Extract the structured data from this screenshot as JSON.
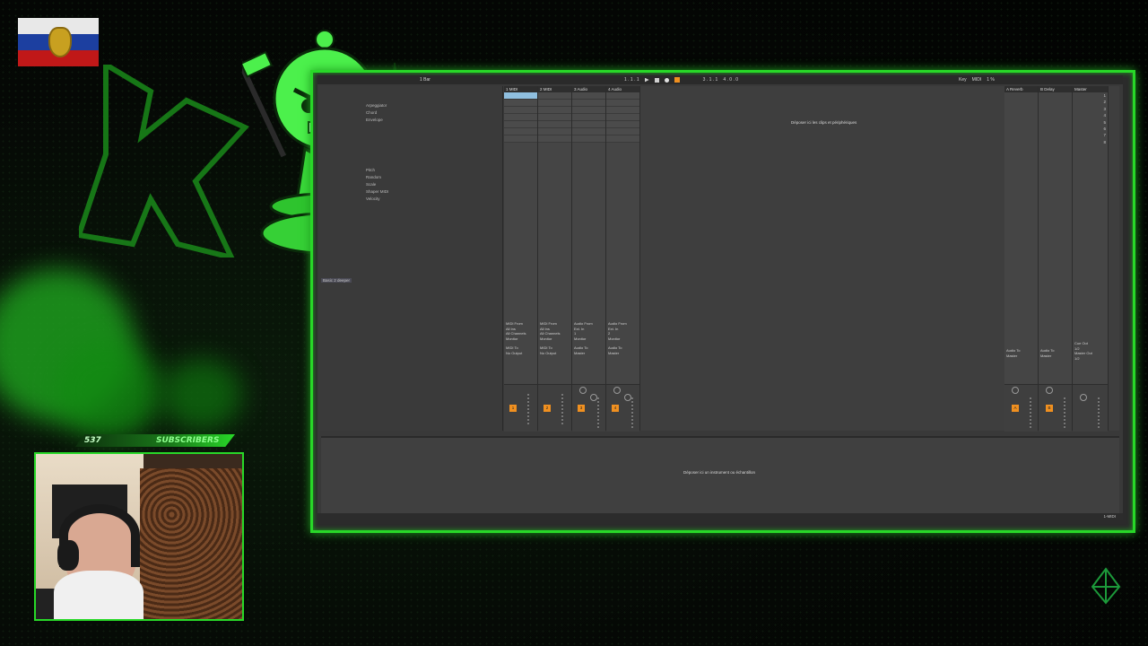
{
  "overlay": {
    "subscribers_count": "537",
    "subscribers_label": "SUBSCRIBERS",
    "accent_color": "#28d828"
  },
  "app": {
    "topbar": {
      "tempo_label": "1 Bar",
      "position": "1 . 1 . 1",
      "loop": "3 . 1 . 1",
      "loop_len": "4 . 0 . 0",
      "key_label": "Key",
      "midi_label": "MIDI",
      "cpu": "1 %"
    },
    "browser": {
      "items": [
        "Arpeggiator",
        "Chord",
        "Envelope",
        "",
        "",
        "",
        "",
        "",
        "",
        "Pitch",
        "Random",
        "Scale",
        "Shaper MIDI",
        "Velocity"
      ],
      "bottom_item": "Basic 2 deeper"
    },
    "tracks": [
      {
        "name": "1 MIDI",
        "number": "1",
        "from": "MIDI From",
        "from_val": "All Ins",
        "chan": "All Channels",
        "monitor": "Monitor",
        "to": "MIDI To",
        "to_val": "No Output"
      },
      {
        "name": "2 MIDI",
        "number": "2",
        "from": "MIDI From",
        "from_val": "All Ins",
        "chan": "All Channels",
        "monitor": "Monitor",
        "to": "MIDI To",
        "to_val": "No Output"
      },
      {
        "name": "3 Audio",
        "number": "3",
        "from": "Audio From",
        "from_val": "Ext. In",
        "chan": "1",
        "monitor": "Monitor",
        "to": "Audio To",
        "to_val": "Master"
      },
      {
        "name": "4 Audio",
        "number": "4",
        "from": "Audio From",
        "from_val": "Ext. In",
        "chan": "2",
        "monitor": "Monitor",
        "to": "Audio To",
        "to_val": "Master"
      }
    ],
    "returns": [
      {
        "name": "A Reverb",
        "number": "A",
        "to": "Audio To",
        "to_val": "Master"
      },
      {
        "name": "B Delay",
        "number": "B",
        "to": "Audio To",
        "to_val": "Master"
      },
      {
        "name": "Master",
        "number": "",
        "to": "Cue Out",
        "to_val": "1/2"
      }
    ],
    "master_out": {
      "label": "Master Out",
      "value": "1/2"
    },
    "scene_numbers": [
      "1",
      "2",
      "3",
      "4",
      "5",
      "6",
      "7",
      "8"
    ],
    "drop_clips_text": "Déposer ici les clips et périphériques",
    "drop_instrument_text": "Déposer ici un instrument ou échantillon",
    "status_right": "1-MIDI"
  }
}
